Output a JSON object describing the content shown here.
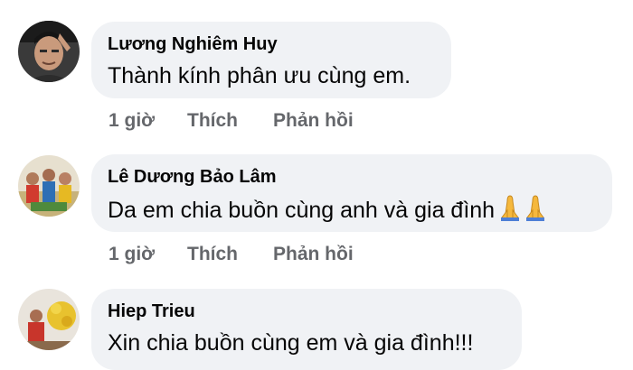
{
  "comments": [
    {
      "author": "Lương Nghiêm Huy",
      "text": "Thành kính phân ưu cùng em.",
      "time": "1 giờ",
      "like_label": "Thích",
      "reply_label": "Phản hồi",
      "avatar_icon": "profile-photo-man"
    },
    {
      "author": "Lê Dương Bảo Lâm",
      "text": "Da em chia buồn cùng anh và gia đình",
      "emoji": "folded-hands-icon",
      "time": "1 giờ",
      "like_label": "Thích",
      "reply_label": "Phản hồi",
      "avatar_icon": "profile-photo-group"
    },
    {
      "author": "Hiep Trieu",
      "text": "Xin chia buồn cùng em và gia đình!!!",
      "avatar_icon": "profile-photo-flowers"
    }
  ],
  "colors": {
    "bubble": "#f0f2f5",
    "name": "#050505",
    "meta": "#65676b"
  }
}
